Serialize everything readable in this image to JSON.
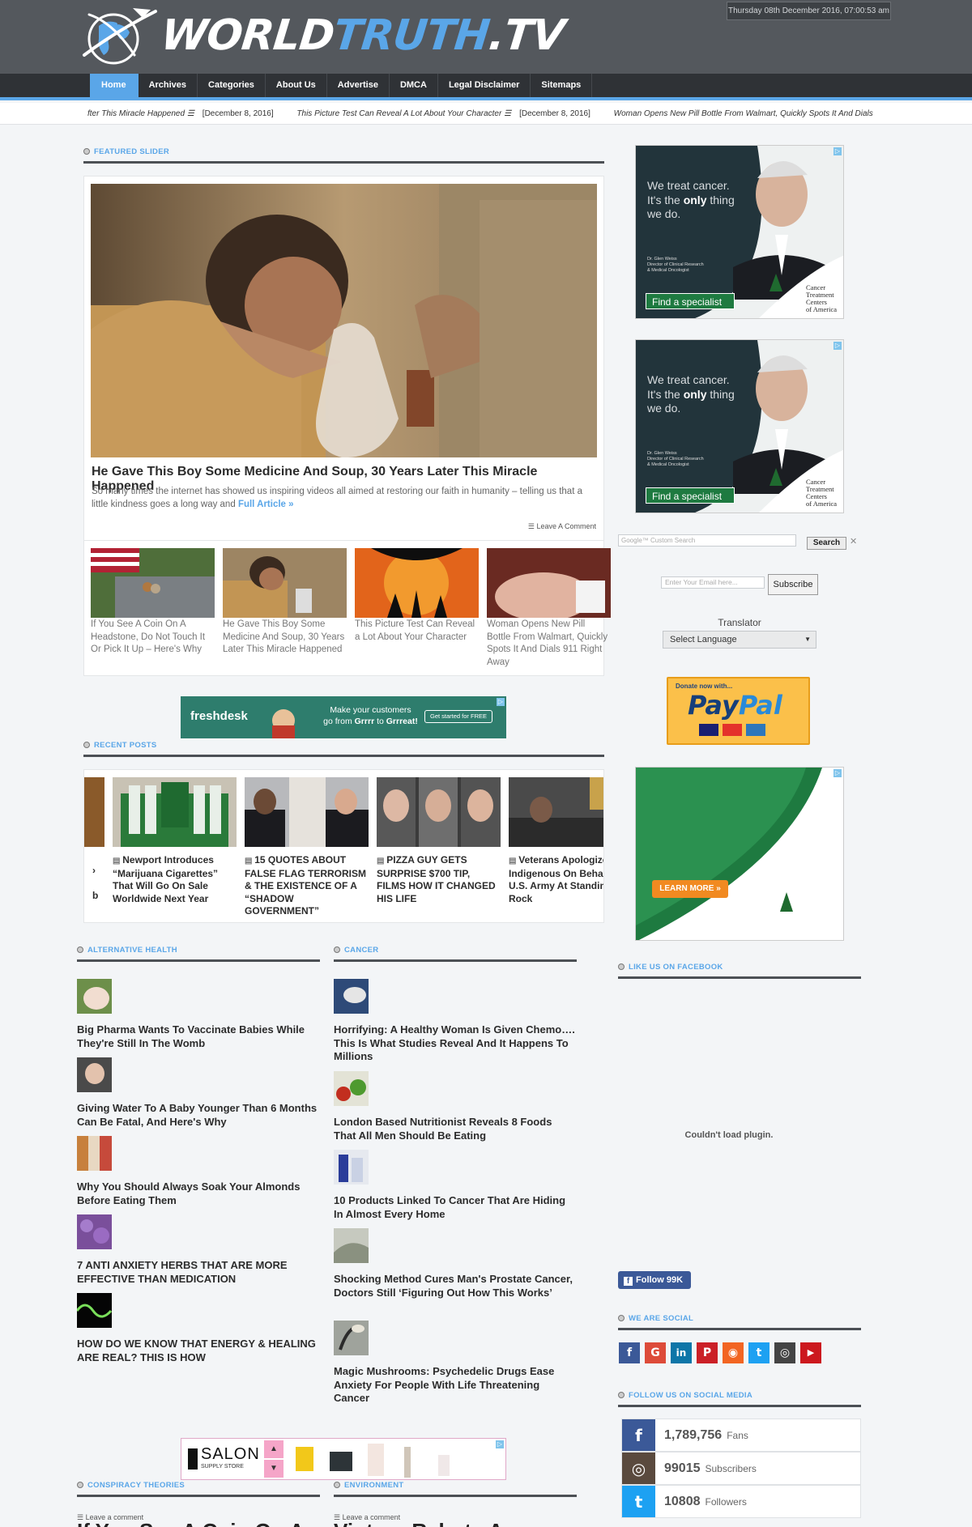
{
  "header": {
    "logo_main": "WORLD",
    "logo_accent": "TRUTH",
    "logo_suffix": ".TV",
    "datetime": "Thursday 08th December 2016, 07:00:53 am"
  },
  "nav": [
    "Home",
    "Archives",
    "Categories",
    "About Us",
    "Advertise",
    "DMCA",
    "Legal Disclaimer",
    "Sitemaps"
  ],
  "ticker": [
    {
      "title": "fter This Miracle Happened ☰",
      "date": "[December 8, 2016]"
    },
    {
      "title": "This Picture Test Can Reveal A Lot About Your Character ☰",
      "date": "[December 8, 2016]"
    },
    {
      "title": "Woman Opens New Pill Bottle From Walmart, Quickly Spots It And Dials",
      "date": ""
    }
  ],
  "sections": {
    "featured": "FEATURED SLIDER",
    "recent": "RECENT POSTS",
    "alt_health": "ALTERNATIVE HEALTH",
    "cancer": "CANCER",
    "facebook": "LIKE US ON FACEBOOK",
    "social": "WE ARE SOCIAL",
    "follow": "FOLLOW US ON SOCIAL MEDIA",
    "conspiracy": "CONSPIRACY THEORIES",
    "environment": "ENVIRONMENT"
  },
  "featured": {
    "title": "He Gave This Boy Some Medicine And Soup, 30 Years Later This Miracle Happened",
    "excerpt": "So many times the internet has showed us inspiring videos all aimed at restoring our faith in humanity – telling us that a little kindness goes a long way and",
    "more": "Full Article »",
    "comment": "☰ Leave A Comment",
    "thumbs": [
      "If You See A Coin On A Headstone, Do Not Touch It Or Pick It Up – Here's Why",
      "He Gave This Boy Some Medicine And Soup, 30 Years Later This Miracle Happened",
      "This Picture Test Can Reveal a Lot About Your Character",
      "Woman Opens New Pill Bottle From Walmart, Quickly Spots It And Dials 911 Right Away"
    ]
  },
  "ads": {
    "freshdesk_brand": "freshdesk",
    "freshdesk_text_1": "Make your customers",
    "freshdesk_text_2_a": "go from ",
    "freshdesk_text_2_b": "Grrrr",
    "freshdesk_text_2_c": " to ",
    "freshdesk_text_2_d": "Grrreat!",
    "freshdesk_cta": "Get started for FREE",
    "cancer_line1": "We treat cancer.",
    "cancer_line2_a": "It's the ",
    "cancer_line2_b": "only",
    "cancer_line2_c": " thing",
    "cancer_line3": "we do.",
    "cancer_doc_1": "Dr. Glen Weiss",
    "cancer_doc_2": "Director of Clinical Research",
    "cancer_doc_3": "& Medical Oncologist",
    "cancer_button": "Find a specialist",
    "cancer_logo_1": "Cancer",
    "cancer_logo_2": "Treatment",
    "cancer_logo_3": "Centers",
    "cancer_logo_4": "of America",
    "learn_more": "LEARN MORE »",
    "salon_brand": "SALON",
    "salon_sub": "SUPPLY STORE"
  },
  "recent": [
    "",
    "Newport Introduces “Marijuana Cigarettes” That Will Go On Sale Worldwide Next Year",
    "15 QUOTES ABOUT FALSE FLAG TERRORISM & THE EXISTENCE OF A “SHADOW GOVERNMENT”",
    "PIZZA GUY GETS SURPRISE $700 TIP, FILMS HOW IT CHANGED HIS LIFE",
    "Veterans Apologize To Indigenous On Behalf Of U.S. Army At Standing Rock"
  ],
  "recent_partial_first": [
    "",
    ""
  ],
  "alt_health": [
    "Big Pharma Wants To Vaccinate Babies While They're Still In The Womb",
    "Giving Water To A Baby Younger Than 6 Months Can Be Fatal, And Here's Why",
    "Why You Should Always Soak Your Almonds Before Eating Them",
    "7 ANTI ANXIETY HERBS THAT ARE MORE EFFECTIVE THAN MEDICATION",
    "HOW DO WE KNOW THAT ENERGY & HEALING ARE REAL? THIS IS HOW"
  ],
  "cancer": [
    "Horrifying: A Healthy Woman Is Given Chemo…. This Is What Studies Reveal And It Happens To Millions",
    "London Based Nutritionist Reveals 8 Foods That All Men Should Be Eating",
    "10 Products Linked To Cancer That Are Hiding In Almost Every Home",
    "Shocking Method Cures Man's Prostate Cancer, Doctors Still ‘Figuring Out How This Works’",
    "Magic Mushrooms: Psychedelic Drugs Ease Anxiety For People With Life Threatening Cancer"
  ],
  "sidebar": {
    "search_placeholder": "Google™ Custom Search",
    "search_button": "Search",
    "search_clear": "✕",
    "email_placeholder": "Enter Your Email here...",
    "subscribe": "Subscribe",
    "translator": "Translator",
    "language": "Select Language",
    "paypal_donate": "Donate now with...",
    "paypal_pay": "Pay",
    "paypal_pal": "Pal",
    "plugin_error": "Couldn't load plugin.",
    "fb_follow": "Follow 99K"
  },
  "social_icons": [
    {
      "icon": "facebook-icon",
      "glyph": "f",
      "color": "#3b5998"
    },
    {
      "icon": "google-plus-icon",
      "glyph": "G",
      "color": "#dd4b39"
    },
    {
      "icon": "linkedin-icon",
      "glyph": "in",
      "color": "#0e76a8"
    },
    {
      "icon": "pinterest-icon",
      "glyph": "P",
      "color": "#cb2027"
    },
    {
      "icon": "rss-icon",
      "glyph": "◉",
      "color": "#f26522"
    },
    {
      "icon": "twitter-icon",
      "glyph": "t",
      "color": "#1da1f2"
    },
    {
      "icon": "instagram-icon",
      "glyph": "◎",
      "color": "#444444"
    },
    {
      "icon": "youtube-icon",
      "glyph": "▶",
      "color": "#cc181e"
    }
  ],
  "stats": [
    {
      "icon": "facebook-icon",
      "glyph": "f",
      "color": "#3b5998",
      "value": "1,789,756",
      "label": "Fans"
    },
    {
      "icon": "instagram-icon",
      "glyph": "◎",
      "color": "#5a4a3e",
      "value": "99015",
      "label": "Subscribers"
    },
    {
      "icon": "twitter-icon",
      "glyph": "t",
      "color": "#1da1f2",
      "value": "10808",
      "label": "Followers"
    }
  ],
  "bottom": {
    "conspiracy_meta": "☰ Leave a comment",
    "conspiracy_title": "If You See A Coin On A",
    "environment_meta": "☰ Leave a comment",
    "environment_title": "Vintner Rebuts A"
  }
}
